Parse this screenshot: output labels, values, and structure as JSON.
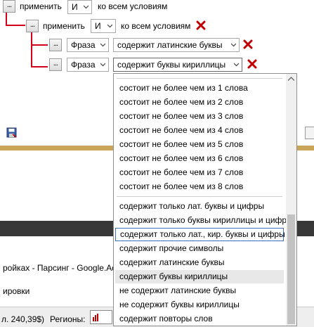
{
  "row1": {
    "dots_label": "...",
    "apply_label": "применить",
    "logic_value": "И",
    "suffix_label": "ко всем условиям"
  },
  "row2": {
    "dots_label": "...",
    "apply_label": "применить",
    "logic_value": "И",
    "suffix_label": "ко всем условиям"
  },
  "cond1": {
    "dots_label": "...",
    "field_value": "Фраза",
    "operator_value": "содержит латинские буквы"
  },
  "cond2": {
    "dots_label": "...",
    "field_value": "Фраза",
    "operator_value": "содержит буквы кириллицы"
  },
  "background": {
    "line1": "ройках - Парсинг - Google.Adv",
    "line2": "ировки",
    "status_text": "л. 240,39$)",
    "regions_label": "Регионы:"
  },
  "dropdown": {
    "group1": [
      "состоит не более чем из 1 слова",
      "состоит не более чем из 2 слов",
      "состоит не более чем из 3 слов",
      "состоит не более чем из 4 слов",
      "состоит не более чем из 5 слов",
      "состоит не более чем из 6 слов",
      "состоит не более чем из 7 слов",
      "состоит не более чем из 8 слов"
    ],
    "group2": [
      "содержит только лат. буквы и цифры",
      "содержит только буквы кириллицы и цифры",
      "содержит только лат., кир. буквы и цифры",
      "содержит прочие символы",
      "содержит латинские буквы",
      "содержит буквы кириллицы",
      "не содержит латинские буквы",
      "не содержит буквы кириллицы",
      "содержит повторы слов"
    ]
  },
  "icons": {
    "remove": "red-x-icon",
    "dropdown_arrow": "chevron-down-icon",
    "save": "floppy-icon"
  },
  "colors": {
    "tree_line": "#d2001a",
    "remove_icon": "#c00000",
    "gold_band": "#c9a65a",
    "focus_border": "#3d6fc4"
  }
}
